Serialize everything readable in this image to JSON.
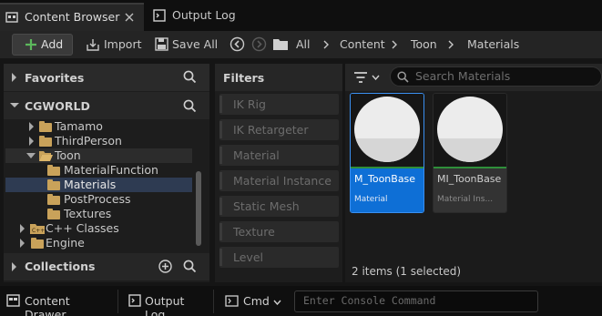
{
  "tabs": [
    {
      "label": "Content Browser",
      "icon": "content-browser-icon"
    },
    {
      "label": "Output Log",
      "icon": "output-log-icon"
    }
  ],
  "toolbar": {
    "add_label": "Add",
    "import_label": "Import",
    "save_all_label": "Save All",
    "breadcrumb": [
      "All",
      "Content",
      "Toon",
      "Materials"
    ]
  },
  "left_panel": {
    "favorites_label": "Favorites",
    "project_label": "CGWORLD",
    "tree": [
      {
        "label": "Tamamo",
        "expanded": false
      },
      {
        "label": "ThirdPerson",
        "expanded": false
      },
      {
        "label": "Toon",
        "expanded": true
      },
      {
        "label": "MaterialFunction",
        "expanded": null
      },
      {
        "label": "Materials",
        "expanded": null,
        "selected": true
      },
      {
        "label": "PostProcess",
        "expanded": null
      },
      {
        "label": "Textures",
        "expanded": null
      },
      {
        "label": "C++ Classes",
        "expanded": false
      },
      {
        "label": "Engine",
        "expanded": false
      }
    ],
    "collections_label": "Collections"
  },
  "filters": {
    "title": "Filters",
    "items": [
      "IK Rig",
      "IK Retargeter",
      "Material",
      "Material Instance",
      "Static Mesh",
      "Texture",
      "Level"
    ]
  },
  "content": {
    "search_placeholder": "Search Materials",
    "assets": [
      {
        "name": "M_ToonBase",
        "type": "Material",
        "selected": true
      },
      {
        "name": "MI_ToonBase",
        "type": "Material Ins...",
        "selected": false
      }
    ],
    "status": "2 items (1 selected)"
  },
  "bottom_bar": {
    "content_drawer_label": "Content Drawer",
    "output_log_label": "Output Log",
    "cmd_label": "Cmd",
    "console_placeholder": "Enter Console Command"
  },
  "colors": {
    "accent_blue": "#0e6fd6",
    "add_green": "#5cb85c",
    "folder": "#c9a25a",
    "material_green": "#2f8f3a"
  }
}
